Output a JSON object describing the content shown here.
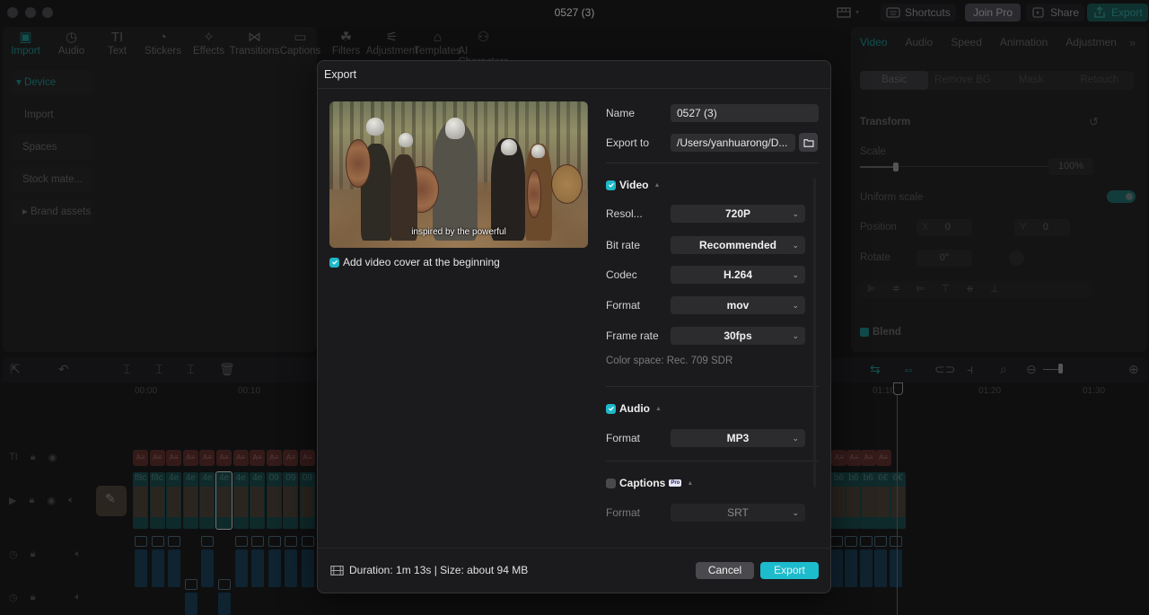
{
  "window": {
    "title": "0527 (3)",
    "top_buttons": {
      "shortcuts": "Shortcuts",
      "join_pro": "Join Pro",
      "share": "Share",
      "export": "Export"
    }
  },
  "left_panel": {
    "tool_tabs": [
      {
        "label": "Import",
        "icon": "import-icon",
        "glyph": "▣",
        "active": true
      },
      {
        "label": "Audio",
        "icon": "audio-icon",
        "glyph": "◷"
      },
      {
        "label": "Text",
        "icon": "text-icon",
        "glyph": "TI"
      },
      {
        "label": "Stickers",
        "icon": "sticker-icon",
        "glyph": "◔"
      },
      {
        "label": "Effects",
        "icon": "effects-icon",
        "glyph": "✧"
      },
      {
        "label": "Transitions",
        "icon": "transitions-icon",
        "glyph": "⋈"
      },
      {
        "label": "Captions",
        "icon": "captions-icon",
        "glyph": "▭"
      },
      {
        "label": "Filters",
        "icon": "filters-icon",
        "glyph": "☘"
      },
      {
        "label": "Adjustment",
        "icon": "adjustment-icon",
        "glyph": "⚟"
      },
      {
        "label": "Templates",
        "icon": "templates-icon",
        "glyph": "⌂"
      },
      {
        "label": "AI Characters",
        "icon": "ai-characters-icon",
        "glyph": "⚇"
      }
    ],
    "side_nav": [
      {
        "label": "▾ Device",
        "active": true
      },
      {
        "label": "Import",
        "plain": true
      },
      {
        "label": "Spaces"
      },
      {
        "label": "Stock mate..."
      },
      {
        "label": "▸ Brand assets"
      }
    ]
  },
  "right_panel": {
    "tabs": [
      "Video",
      "Audio",
      "Speed",
      "Animation",
      "Adjustmen"
    ],
    "active_tab": "Video",
    "more_glyph": "»",
    "subtabs": [
      "Basic",
      "Remove BG",
      "Mask",
      "Retouch"
    ],
    "active_subtab": "Basic",
    "transform_label": "Transform",
    "scale_label": "Scale",
    "scale_value": "100%",
    "uniform_scale_label": "Uniform scale",
    "uniform_scale_on": true,
    "position_label": "Position",
    "position_x_label": "X",
    "position_x": "0",
    "position_y_label": "Y",
    "position_y": "0",
    "rotate_label": "Rotate",
    "rotate_value": "0°",
    "blend_label": "Blend"
  },
  "timeline": {
    "ruler": [
      "00:00",
      "00:10",
      "01:10",
      "01:20",
      "01:30"
    ],
    "text_clip_label": "A≡",
    "video_clip_labels": [
      "f8c",
      "f8c",
      "4e",
      "4e",
      "4e",
      "4e",
      "4e",
      "4e",
      "09",
      "09",
      "09"
    ],
    "video_clip_labels_right": [
      "b6",
      "b6",
      "b6",
      "6€",
      "6€"
    ]
  },
  "export_dialog": {
    "title": "Export",
    "preview_subtitle": "inspired by the powerful",
    "add_cover_label": "Add video cover at the beginning",
    "add_cover_checked": true,
    "name_label": "Name",
    "name_value": "0527 (3)",
    "export_to_label": "Export to",
    "export_to_value": "/Users/yanhuarong/D...",
    "video": {
      "label": "Video",
      "checked": true,
      "fields": [
        {
          "label": "Resol...",
          "value": "720P"
        },
        {
          "label": "Bit rate",
          "value": "Recommended"
        },
        {
          "label": "Codec",
          "value": "H.264"
        },
        {
          "label": "Format",
          "value": "mov"
        },
        {
          "label": "Frame rate",
          "value": "30fps"
        }
      ],
      "color_space": "Color space: Rec. 709 SDR"
    },
    "audio": {
      "label": "Audio",
      "checked": true,
      "format_label": "Format",
      "format_value": "MP3"
    },
    "captions": {
      "label": "Captions",
      "checked": false,
      "pro_badge": "Pro",
      "format_label": "Format",
      "format_value": "SRT"
    },
    "footer_info": "Duration: 1m 13s | Size: about 94 MB",
    "cancel_label": "Cancel",
    "export_label": "Export"
  },
  "colors": {
    "accent": "#1cbccd",
    "cancel_bg": "#4a4a4e",
    "dialog_bg": "#1b1b1d"
  }
}
